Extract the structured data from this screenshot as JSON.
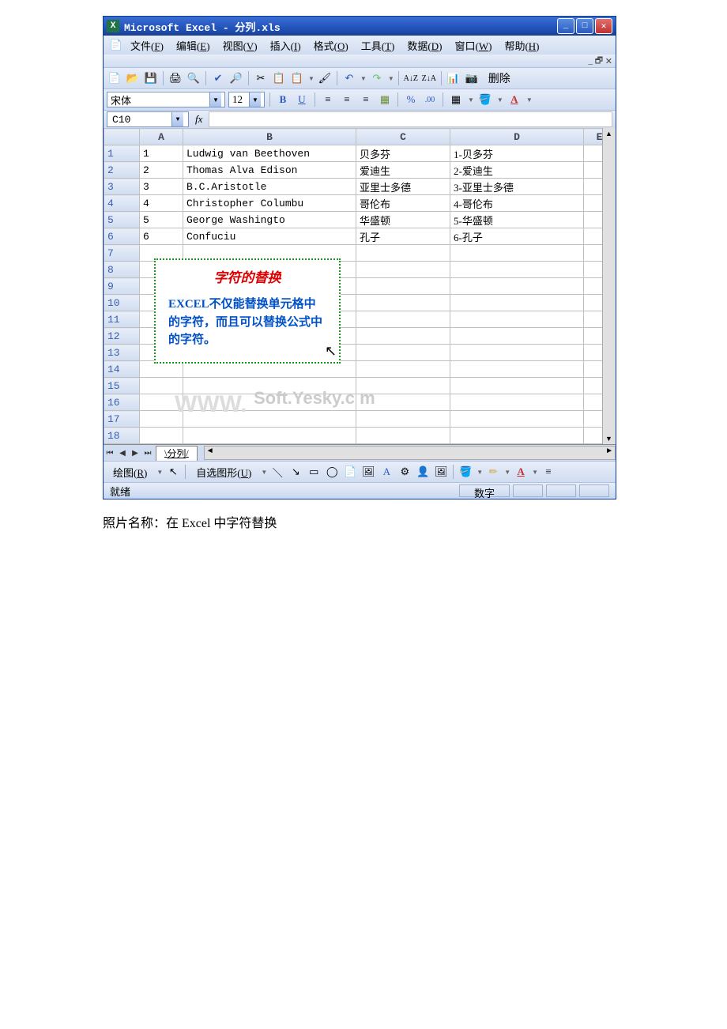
{
  "window": {
    "title": "Microsoft Excel - 分列.xls"
  },
  "menu": {
    "file": "文件(F)",
    "edit": "编辑(E)",
    "view": "视图(V)",
    "insert": "插入(I)",
    "format": "格式(O)",
    "tools": "工具(T)",
    "data": "数据(D)",
    "window": "窗口(W)",
    "help": "帮助(H)"
  },
  "fontbar": {
    "font": "宋体",
    "size": "12"
  },
  "toolbar": {
    "delete": "删除"
  },
  "namebox": "C10",
  "fx_label": "fx",
  "columns": [
    "A",
    "B",
    "C",
    "D",
    "E"
  ],
  "rows": [
    {
      "n": "1",
      "a": "1",
      "b": "Ludwig van Beethoven",
      "c": "贝多芬",
      "d": "1-贝多芬"
    },
    {
      "n": "2",
      "a": "2",
      "b": "Thomas Alva Edison",
      "c": "爱迪生",
      "d": "2-爱迪生"
    },
    {
      "n": "3",
      "a": "3",
      "b": "B.C.Aristotle",
      "c": "亚里士多德",
      "d": "3-亚里士多德"
    },
    {
      "n": "4",
      "a": "4",
      "b": "Christopher Columbu",
      "c": "哥伦布",
      "d": "4-哥伦布"
    },
    {
      "n": "5",
      "a": "5",
      "b": "George Washingto",
      "c": "华盛顿",
      "d": "5-华盛顿"
    },
    {
      "n": "6",
      "a": "6",
      "b": "Confuciu",
      "c": "孔子",
      "d": "6-孔子"
    },
    {
      "n": "7"
    },
    {
      "n": "8"
    },
    {
      "n": "9"
    },
    {
      "n": "10"
    },
    {
      "n": "11"
    },
    {
      "n": "12"
    },
    {
      "n": "13"
    },
    {
      "n": "14"
    },
    {
      "n": "15"
    },
    {
      "n": "16"
    },
    {
      "n": "17"
    },
    {
      "n": "18"
    }
  ],
  "note": {
    "title": "字符的替换",
    "body": "EXCEL不仅能替换单元格中的字符，而且可以替换公式中的字符。"
  },
  "watermark1": "WWW.",
  "watermark2": "Soft.Yesky.c     m",
  "sheet_tab": "分列",
  "drawbar": {
    "draw": "绘图(R)",
    "autoshapes": "自选图形(U)"
  },
  "status": {
    "ready": "就绪",
    "num": "数字"
  },
  "caption": "照片名称：在 Excel 中字符替换"
}
